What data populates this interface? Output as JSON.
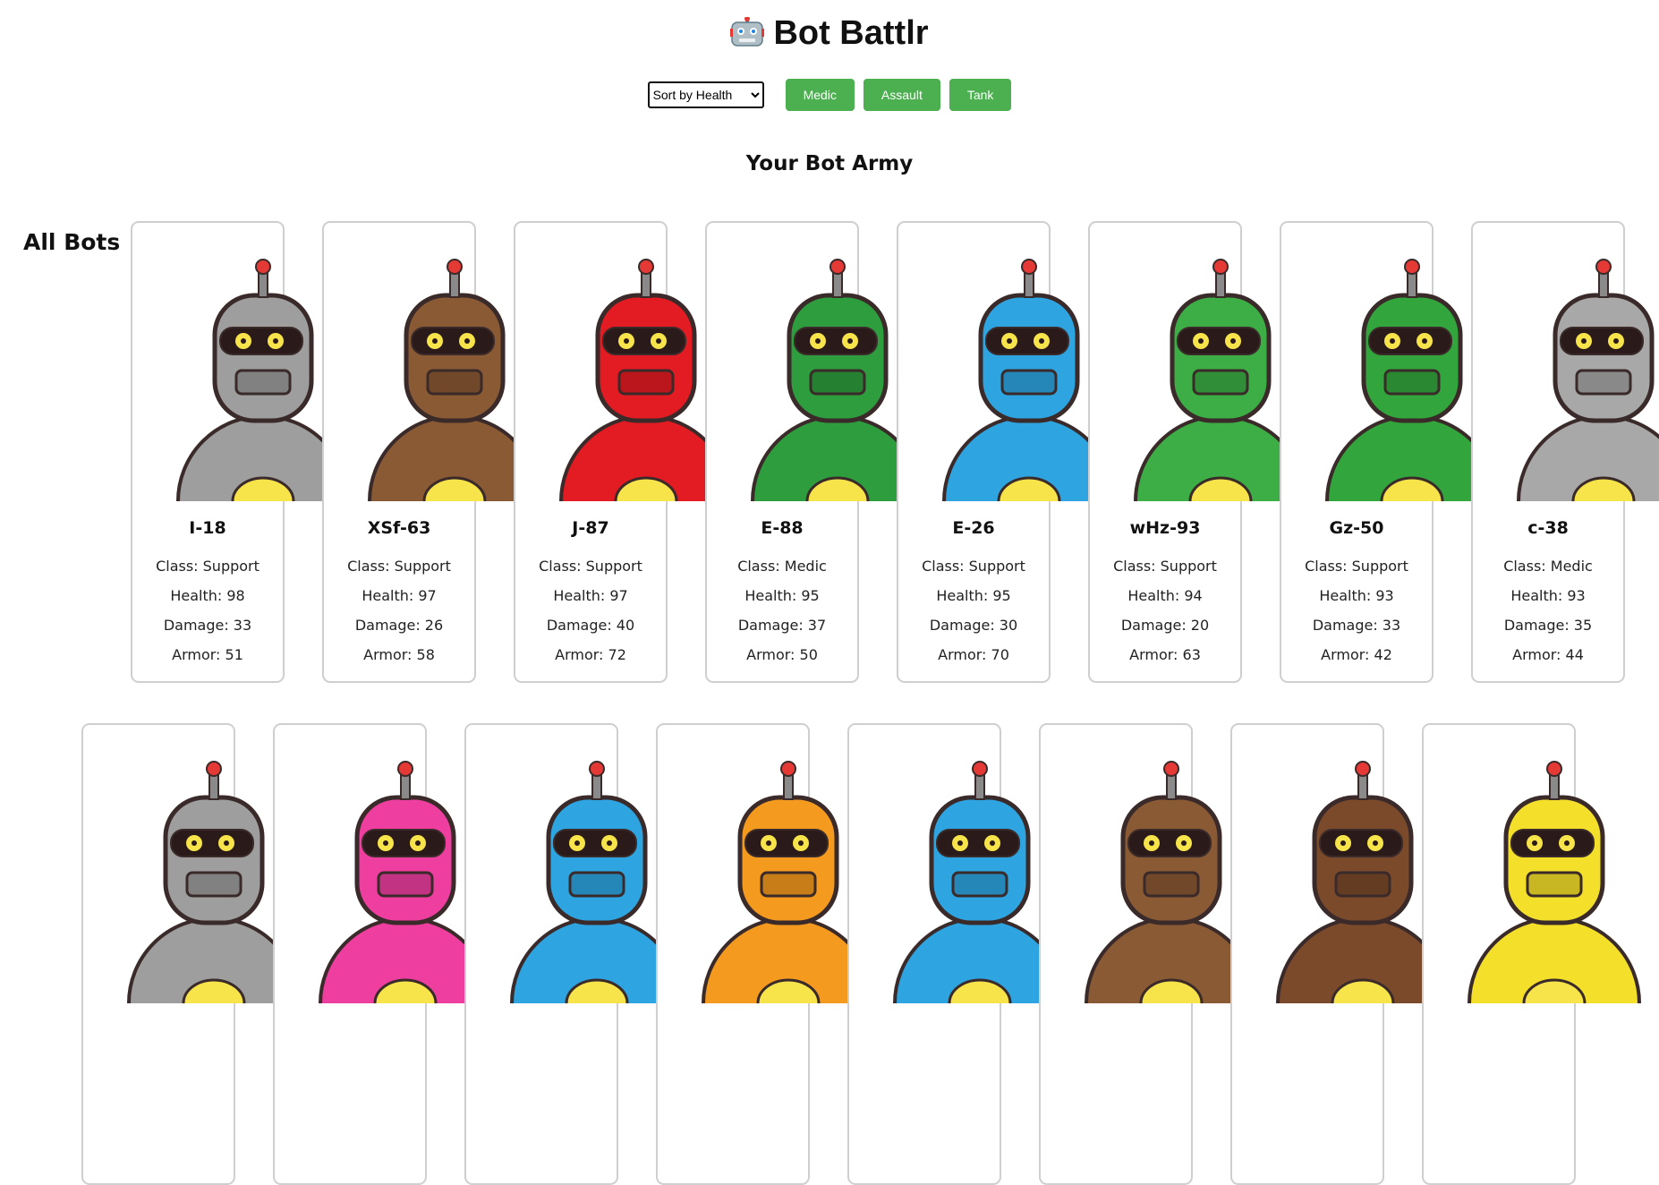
{
  "app": {
    "title": "Bot Battlr",
    "title_icon": "robot-emoji"
  },
  "controls": {
    "sort": {
      "selected": "Sort by Health"
    },
    "filters": [
      {
        "label": "Medic"
      },
      {
        "label": "Assault"
      },
      {
        "label": "Tank"
      }
    ]
  },
  "army": {
    "heading": "Your Bot Army"
  },
  "all_bots": {
    "heading": "All Bots",
    "bots": [
      {
        "name": "I-18",
        "class_text": "Class: Support",
        "health_text": "Health: 98",
        "damage_text": "Damage: 33",
        "armor_text": "Armor: 51",
        "color": "#9e9e9e"
      },
      {
        "name": "XSf-63",
        "class_text": "Class: Support",
        "health_text": "Health: 97",
        "damage_text": "Damage: 26",
        "armor_text": "Armor: 58",
        "color": "#8a5a34"
      },
      {
        "name": "J-87",
        "class_text": "Class: Support",
        "health_text": "Health: 97",
        "damage_text": "Damage: 40",
        "armor_text": "Armor: 72",
        "color": "#e31b23"
      },
      {
        "name": "E-88",
        "class_text": "Class: Medic",
        "health_text": "Health: 95",
        "damage_text": "Damage: 37",
        "armor_text": "Armor: 50",
        "color": "#2e9d3e"
      },
      {
        "name": "E-26",
        "class_text": "Class: Support",
        "health_text": "Health: 95",
        "damage_text": "Damage: 30",
        "armor_text": "Armor: 70",
        "color": "#2ea5e0"
      },
      {
        "name": "wHz-93",
        "class_text": "Class: Support",
        "health_text": "Health: 94",
        "damage_text": "Damage: 20",
        "armor_text": "Armor: 63",
        "color": "#3cae45"
      },
      {
        "name": "Gz-50",
        "class_text": "Class: Support",
        "health_text": "Health: 93",
        "damage_text": "Damage: 33",
        "armor_text": "Armor: 42",
        "color": "#32a63c"
      },
      {
        "name": "c-38",
        "class_text": "Class: Medic",
        "health_text": "Health: 93",
        "damage_text": "Damage: 35",
        "armor_text": "Armor: 44",
        "color": "#a8a8a8"
      }
    ],
    "partial_row_colors": [
      "#9e9e9e",
      "#ee3fa0",
      "#2ea5e0",
      "#f39a1f",
      "#2ea5e0",
      "#8a5a34",
      "#7b4a2a",
      "#f4e02a"
    ]
  }
}
